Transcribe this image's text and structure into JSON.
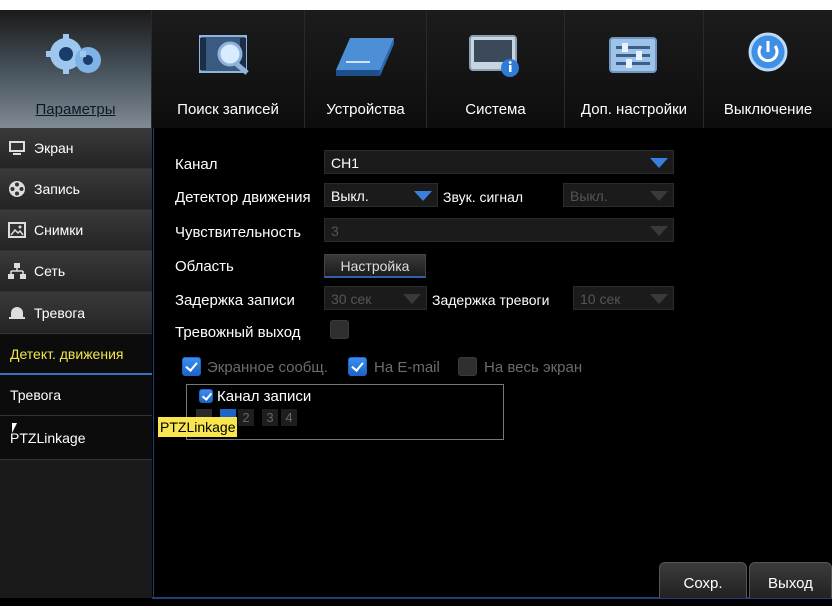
{
  "topnav": {
    "tabs": [
      {
        "label": "Параметры",
        "icon": "gears-icon",
        "active": true
      },
      {
        "label": "Поиск записей",
        "icon": "search-records-icon",
        "active": false
      },
      {
        "label": "Устройства",
        "icon": "hdd-icon",
        "active": false
      },
      {
        "label": "Система",
        "icon": "system-info-icon",
        "active": false
      },
      {
        "label": "Доп. настройки",
        "icon": "advanced-settings-icon",
        "active": false
      },
      {
        "label": "Выключение",
        "icon": "power-icon",
        "active": false
      }
    ]
  },
  "sidebar": {
    "main_items": [
      {
        "label": "Экран",
        "icon": "monitor-icon"
      },
      {
        "label": "Запись",
        "icon": "film-reel-icon"
      },
      {
        "label": "Снимки",
        "icon": "snapshot-icon"
      },
      {
        "label": "Сеть",
        "icon": "network-icon"
      },
      {
        "label": "Тревога",
        "icon": "alarm-bell-icon"
      }
    ],
    "sub_items": [
      {
        "label": "Детект. движения",
        "active": true
      },
      {
        "label": "Тревога",
        "active": false
      },
      {
        "label": "PTZLinkage",
        "active": false
      }
    ]
  },
  "form": {
    "channel_label": "Канал",
    "channel_value": "CH1",
    "motion_label": "Детектор движения",
    "motion_value": "Выкл.",
    "buzzer_label": "Звук. сигнал",
    "buzzer_value": "Выкл.",
    "sensitivity_label": "Чувствительность",
    "sensitivity_value": "3",
    "area_label": "Область",
    "area_button": "Настройка",
    "rec_delay_label": "Задержка записи",
    "rec_delay_value": "30 сек",
    "alarm_delay_label": "Задержка тревоги",
    "alarm_delay_value": "10 сек",
    "alarm_out_label": "Тревожный выход",
    "alarm_out_checked": false,
    "screen_msg_label": "Экранное сообщ.",
    "screen_msg_checked": true,
    "email_label": "На E-mail",
    "email_checked": true,
    "fullscreen_label": "На весь экран",
    "fullscreen_checked": false,
    "record_channel_label": "Канал записи",
    "record_channel_checked": true,
    "channels": [
      "1",
      "2",
      "3",
      "4"
    ]
  },
  "tooltip": "PTZLinkage",
  "footer": {
    "save_label": "Сохр.",
    "exit_label": "Выход"
  },
  "colors": {
    "accent_blue": "#1d64c8",
    "active_sub_text": "#f2e64d",
    "tooltip_bg": "#f7e64e"
  }
}
